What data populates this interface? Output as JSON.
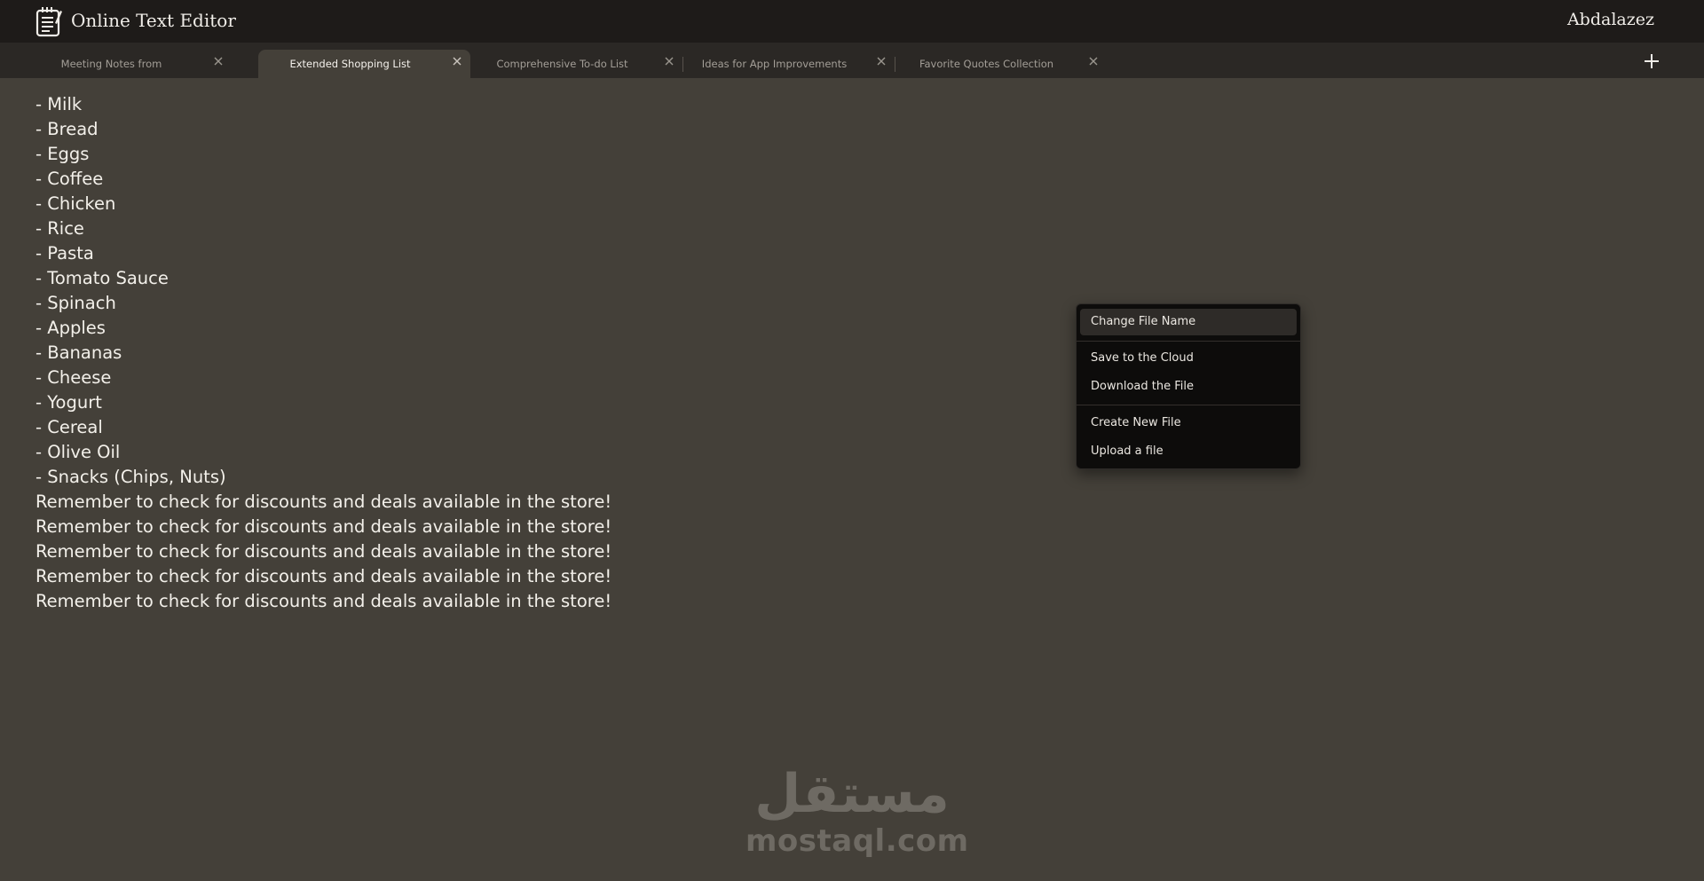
{
  "app": {
    "title": "Online Text Editor",
    "user": "Abdalazez",
    "logo_icon": "notepad-icon"
  },
  "tabs": [
    {
      "label": "Meeting Notes from",
      "active": false
    },
    {
      "label": "Extended Shopping List",
      "active": true
    },
    {
      "label": "Comprehensive To-do List",
      "active": false
    },
    {
      "label": "Ideas for App Improvements",
      "active": false
    },
    {
      "label": "Favorite Quotes Collection",
      "active": false
    }
  ],
  "document": {
    "lines": [
      "- Milk",
      "- Bread",
      "- Eggs",
      "- Coffee",
      "- Chicken",
      "- Rice",
      "- Pasta",
      "- Tomato Sauce",
      "- Spinach",
      "- Apples",
      "- Bananas",
      "- Cheese",
      "- Yogurt",
      "- Cereal",
      "- Olive Oil",
      "- Snacks (Chips, Nuts)",
      "Remember to check for discounts and deals available in the store!",
      "Remember to check for discounts and deals available in the store!",
      "Remember to check for discounts and deals available in the store!",
      "Remember to check for discounts and deals available in the store!",
      "Remember to check for discounts and deals available in the store!"
    ]
  },
  "context_menu": {
    "items": [
      {
        "label": "Change File Name"
      },
      {
        "label": "Save to the Cloud"
      },
      {
        "label": "Download the File"
      },
      {
        "label": "Create New File"
      },
      {
        "label": "Upload a file"
      }
    ]
  },
  "watermark": {
    "arabic": "مستقل",
    "latin": "mostaql.com"
  },
  "colors": {
    "topbar": "#1e1b19",
    "tabbar": "#2b2825",
    "editor_bg": "#444039",
    "menu_bg": "#0d0c0b"
  }
}
